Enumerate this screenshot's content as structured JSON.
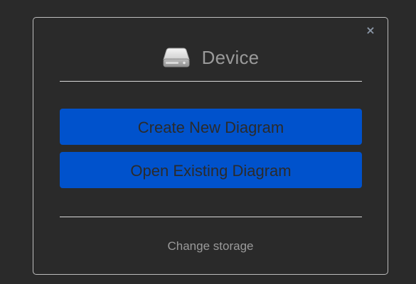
{
  "dialog": {
    "title": "Device",
    "close_label": "×",
    "create_button_label": "Create New Diagram",
    "open_button_label": "Open Existing Diagram",
    "change_storage_label": "Change storage",
    "icon": "hard-drive-icon",
    "close_icon": "close-icon"
  },
  "colors": {
    "background": "#2a2a2a",
    "dialog_border": "#bdbdbd",
    "button_blue": "#0052cc",
    "button_text": "#2b2b2b",
    "muted_text": "#9a9a9a",
    "close_icon": "#8a96a6"
  }
}
